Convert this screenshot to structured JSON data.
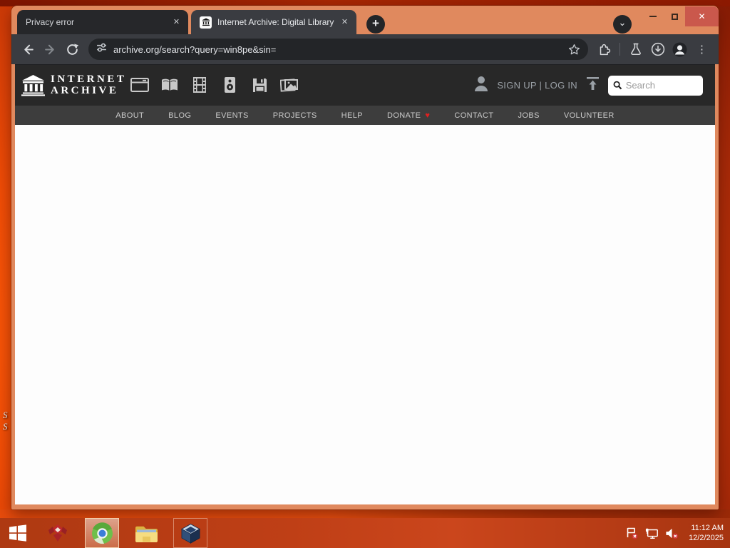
{
  "browser": {
    "tabs": [
      {
        "title": "Privacy error"
      },
      {
        "title": "Internet Archive: Digital Library"
      }
    ],
    "url": "archive.org/search?query=win8pe&sin=",
    "glyphs": {
      "tab_close": "✕",
      "new_tab": "+",
      "tab_search_chevron": "⌄",
      "window_close": "✕",
      "menu_kebab": "⋮"
    }
  },
  "site": {
    "logo_line1": "INTERNET",
    "logo_line2": "ARCHIVE",
    "media_types": [
      "web",
      "texts",
      "video",
      "audio",
      "software",
      "images"
    ],
    "account": {
      "signup_login": "SIGN UP | LOG IN"
    },
    "search_placeholder": "Search",
    "nav": [
      "ABOUT",
      "BLOG",
      "EVENTS",
      "PROJECTS",
      "HELP",
      "DONATE",
      "CONTACT",
      "JOBS",
      "VOLUNTEER"
    ],
    "donate_heart": "♥"
  },
  "desktop": {
    "icon_fragments": [
      "S",
      "S"
    ],
    "taskbar": {
      "clock_time": "11:12 AM",
      "clock_date": "12/2/2025"
    }
  },
  "colors": {
    "frame_salmon": "#e0895e",
    "toolbar_dark": "#3a3c41",
    "window_close_red": "#ca584c",
    "ia_header": "#282828",
    "ia_nav": "#3d3d3d",
    "heart_red": "#e02020",
    "taskbar_orange": "#bd3d15"
  }
}
